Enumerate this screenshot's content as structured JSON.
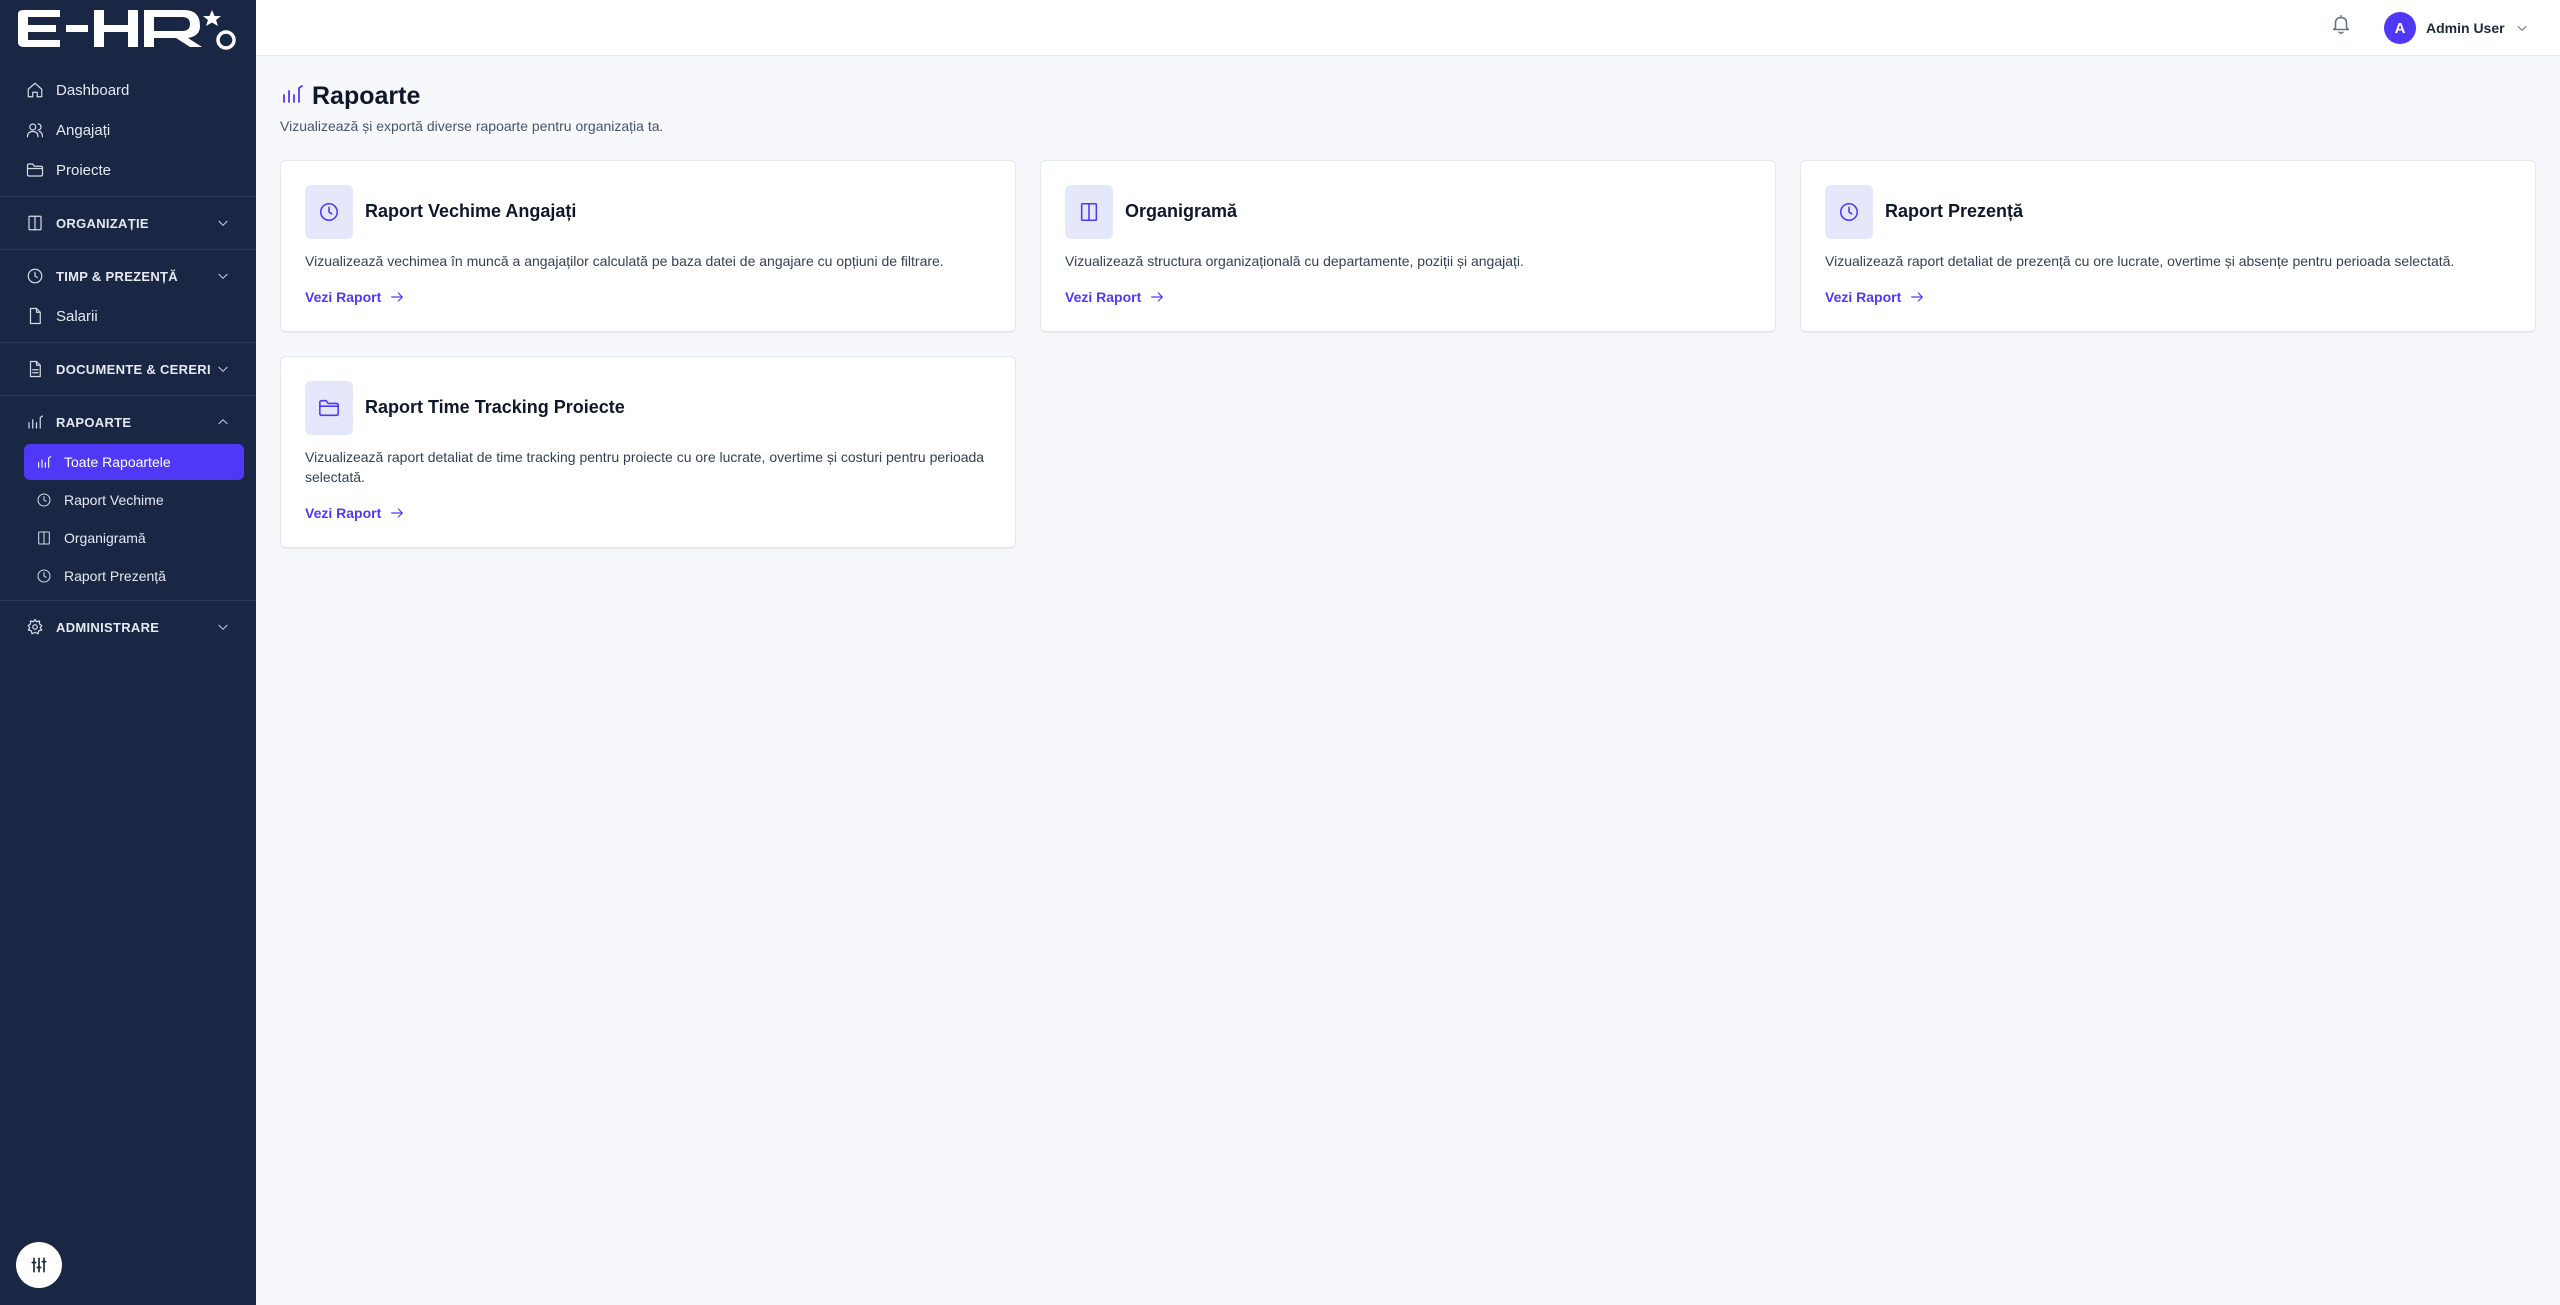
{
  "brand": {
    "logo_text": "E-HR",
    "accent": "#4f39f6",
    "sidebar_bg": "#1a2744"
  },
  "sidebar": {
    "top_items": [
      {
        "label": "Dashboard",
        "icon": "home-icon"
      },
      {
        "label": "Angajați",
        "icon": "users-icon"
      },
      {
        "label": "Proiecte",
        "icon": "folder-icon"
      }
    ],
    "sections": {
      "organizatie": "ORGANIZAȚIE",
      "timp": "TIMP & PREZENȚĂ",
      "salarii": "Salarii",
      "documente": "DOCUMENTE & CERERI",
      "rapoarte": "RAPOARTE",
      "administrare": "ADMINISTRARE"
    },
    "rapoarte_items": [
      {
        "label": "Toate Rapoartele",
        "icon": "chart-icon",
        "active": true
      },
      {
        "label": "Raport Vechime",
        "icon": "clock-icon",
        "active": false
      },
      {
        "label": "Organigramă",
        "icon": "book-icon",
        "active": false
      },
      {
        "label": "Raport Prezență",
        "icon": "clock-icon",
        "active": false
      }
    ]
  },
  "header": {
    "user_initial": "A",
    "user_name": "Admin User"
  },
  "page": {
    "title": "Rapoarte",
    "subtitle": "Vizualizează și exportă diverse rapoarte pentru organizația ta."
  },
  "cards": [
    {
      "title": "Raport Vechime Angajați",
      "description": "Vizualizează vechimea în muncă a angajaților calculată pe baza datei de angajare cu opțiuni de filtrare.",
      "link": "Vezi Raport",
      "icon": "clock-icon"
    },
    {
      "title": "Organigramă",
      "description": "Vizualizează structura organizațională cu departamente, poziții și angajați.",
      "link": "Vezi Raport",
      "icon": "book-icon"
    },
    {
      "title": "Raport Prezență",
      "description": "Vizualizează raport detaliat de prezență cu ore lucrate, overtime și absențe pentru perioada selectată.",
      "link": "Vezi Raport",
      "icon": "clock-icon"
    },
    {
      "title": "Raport Time Tracking Proiecte",
      "description": "Vizualizează raport detaliat de time tracking pentru proiecte cu ore lucrate, overtime și costuri pentru perioada selectată.",
      "link": "Vezi Raport",
      "icon": "folder-icon"
    }
  ]
}
